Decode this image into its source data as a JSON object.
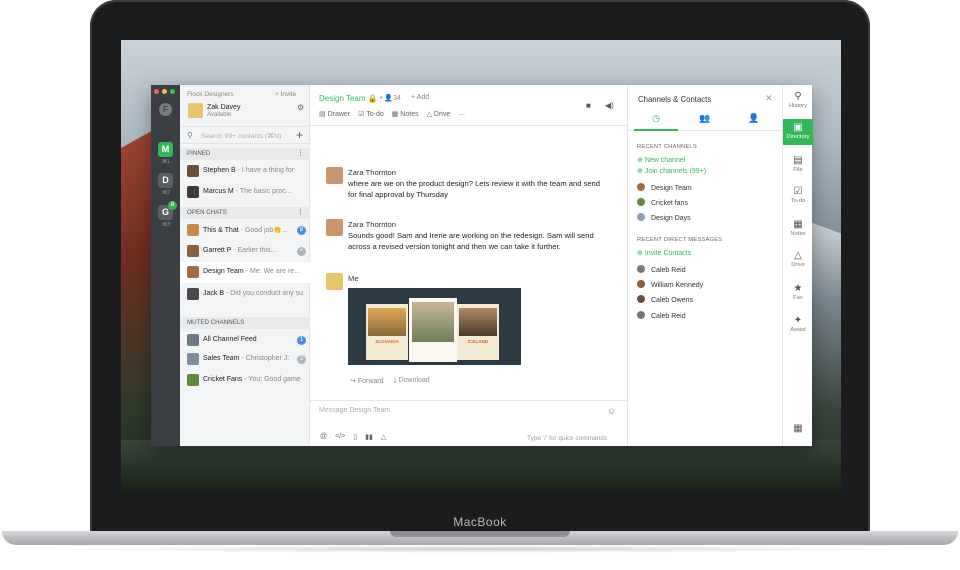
{
  "device_label": "MacBook",
  "team_column": {
    "teams": [
      {
        "letter": "M",
        "color": "#32b858",
        "shortcut": "⌘1"
      },
      {
        "letter": "D",
        "color": "#5a5f66",
        "shortcut": "⌘2"
      },
      {
        "letter": "G",
        "color": "#5a5f66",
        "shortcut": "⌘3",
        "badge": "8"
      }
    ]
  },
  "chat_list": {
    "team_name": "Flock Designers",
    "invite": "+ Invite",
    "user_name": "Zak Davey",
    "user_status": "Available",
    "search_placeholder": "Search 99+ contacts (⌘N)",
    "pinned_header": "PINNED",
    "pinned": [
      {
        "name": "Stephen B",
        "preview": " - I have a thing for",
        "avatar_color": "#6b4f3a"
      },
      {
        "name": "Marcus M",
        "preview": " - The basic proc...",
        "avatar_color": "#3d3d3d"
      }
    ],
    "open_header": "OPEN CHATS",
    "open": [
      {
        "name": "This & That",
        "preview": " - Good job👏...",
        "avatar_color": "#c88a4a",
        "count": "8"
      },
      {
        "name": "Garrett P",
        "preview": " - Earlier this...",
        "avatar_color": "#8b5e3c",
        "count": "×"
      },
      {
        "name": "Design Team",
        "preview": " - Me: We are re...",
        "avatar_color": "#a56a3d"
      },
      {
        "name": "Jack B",
        "preview": " - Did you conduct any su",
        "avatar_color": "#4a4a4a"
      }
    ],
    "muted_header": "MUTED CHANNELS",
    "muted": [
      {
        "name": "All Channel Feed",
        "preview": "",
        "avatar_color": "#6d7a88",
        "count": "1"
      },
      {
        "name": "Sales Team",
        "preview": " - Christopher J:",
        "avatar_color": "#7d8f9c",
        "count": "2"
      },
      {
        "name": "Cricket Fans",
        "preview": " - You: Good game",
        "avatar_color": "#5f8a3b"
      }
    ]
  },
  "main": {
    "channel_title": "Design Team",
    "members": "34",
    "add": "+ Add",
    "tools": [
      "Drawer",
      "To-do",
      "Notes",
      "Drive",
      "…"
    ],
    "messages": [
      {
        "author": "Zara Thornton",
        "text": "where are we on the product design? Lets review it with the team and send for final approval by Thursday"
      },
      {
        "author": "Zara Thornton",
        "text": "Sounds good! Sam and Irene are working on the redesign. Sam will send across a revised version tonight and then we can take it further."
      },
      {
        "author": "Me",
        "text": ""
      }
    ],
    "image_labels": [
      "SLOVAKIA",
      "ICELAND"
    ],
    "forward": "Forward",
    "download": "Download",
    "composer_placeholder": "Message Design Team",
    "composer_hint": "Type '/' for quick commands"
  },
  "right_panel": {
    "title": "Channels & Contacts",
    "recent_channels_header": "RECENT CHANNELS",
    "new_channel": "New channel",
    "join_channels": "Join channels (99+)",
    "channels": [
      {
        "name": "Design Team",
        "color": "#a56a3d"
      },
      {
        "name": "Cricket fans",
        "color": "#5f8a3b"
      },
      {
        "name": "Design Days",
        "color": "#8aa0b4"
      }
    ],
    "recent_dm_header": "RECENT DIRECT MESSAGES",
    "invite_contacts": "Invite Contacts",
    "contacts": [
      {
        "name": "Caleb Reid",
        "color": "#7a7a7a"
      },
      {
        "name": "William Kennedy",
        "color": "#8b5e3c"
      },
      {
        "name": "Caleb Owens",
        "color": "#6b5040"
      },
      {
        "name": "Caleb Reid",
        "color": "#777"
      }
    ]
  },
  "rail": {
    "items": [
      "History",
      "Directory",
      "File",
      "To-do",
      "Notes",
      "Drive",
      "Fav",
      "Assist"
    ]
  },
  "colors": {
    "accent": "#32b858",
    "badge_blue": "#4a90e2"
  }
}
